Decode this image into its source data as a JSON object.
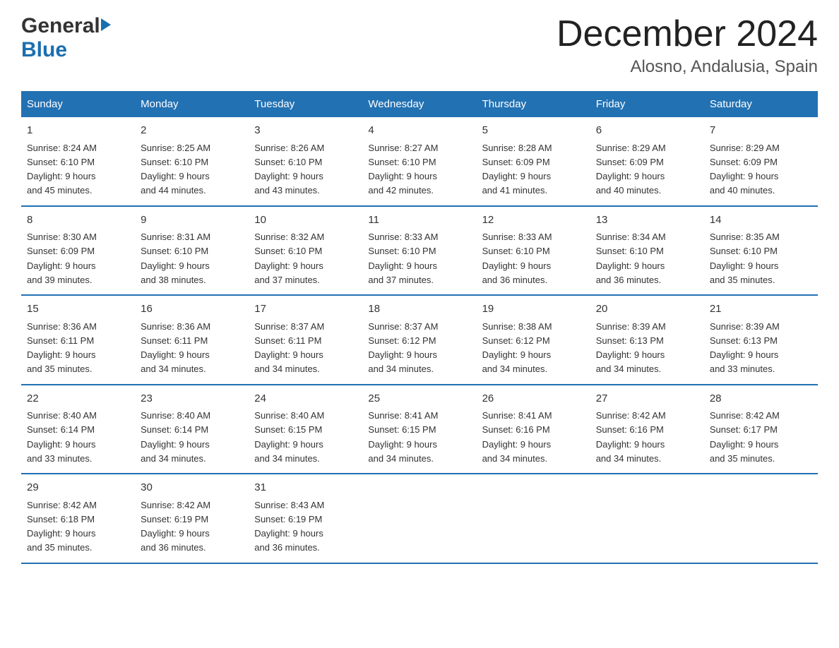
{
  "header": {
    "logo_general": "General",
    "logo_blue": "Blue",
    "title": "December 2024",
    "subtitle": "Alosno, Andalusia, Spain"
  },
  "weekdays": [
    "Sunday",
    "Monday",
    "Tuesday",
    "Wednesday",
    "Thursday",
    "Friday",
    "Saturday"
  ],
  "weeks": [
    [
      {
        "day": "1",
        "sunrise": "8:24 AM",
        "sunset": "6:10 PM",
        "daylight": "9 hours and 45 minutes."
      },
      {
        "day": "2",
        "sunrise": "8:25 AM",
        "sunset": "6:10 PM",
        "daylight": "9 hours and 44 minutes."
      },
      {
        "day": "3",
        "sunrise": "8:26 AM",
        "sunset": "6:10 PM",
        "daylight": "9 hours and 43 minutes."
      },
      {
        "day": "4",
        "sunrise": "8:27 AM",
        "sunset": "6:10 PM",
        "daylight": "9 hours and 42 minutes."
      },
      {
        "day": "5",
        "sunrise": "8:28 AM",
        "sunset": "6:09 PM",
        "daylight": "9 hours and 41 minutes."
      },
      {
        "day": "6",
        "sunrise": "8:29 AM",
        "sunset": "6:09 PM",
        "daylight": "9 hours and 40 minutes."
      },
      {
        "day": "7",
        "sunrise": "8:29 AM",
        "sunset": "6:09 PM",
        "daylight": "9 hours and 40 minutes."
      }
    ],
    [
      {
        "day": "8",
        "sunrise": "8:30 AM",
        "sunset": "6:09 PM",
        "daylight": "9 hours and 39 minutes."
      },
      {
        "day": "9",
        "sunrise": "8:31 AM",
        "sunset": "6:10 PM",
        "daylight": "9 hours and 38 minutes."
      },
      {
        "day": "10",
        "sunrise": "8:32 AM",
        "sunset": "6:10 PM",
        "daylight": "9 hours and 37 minutes."
      },
      {
        "day": "11",
        "sunrise": "8:33 AM",
        "sunset": "6:10 PM",
        "daylight": "9 hours and 37 minutes."
      },
      {
        "day": "12",
        "sunrise": "8:33 AM",
        "sunset": "6:10 PM",
        "daylight": "9 hours and 36 minutes."
      },
      {
        "day": "13",
        "sunrise": "8:34 AM",
        "sunset": "6:10 PM",
        "daylight": "9 hours and 36 minutes."
      },
      {
        "day": "14",
        "sunrise": "8:35 AM",
        "sunset": "6:10 PM",
        "daylight": "9 hours and 35 minutes."
      }
    ],
    [
      {
        "day": "15",
        "sunrise": "8:36 AM",
        "sunset": "6:11 PM",
        "daylight": "9 hours and 35 minutes."
      },
      {
        "day": "16",
        "sunrise": "8:36 AM",
        "sunset": "6:11 PM",
        "daylight": "9 hours and 34 minutes."
      },
      {
        "day": "17",
        "sunrise": "8:37 AM",
        "sunset": "6:11 PM",
        "daylight": "9 hours and 34 minutes."
      },
      {
        "day": "18",
        "sunrise": "8:37 AM",
        "sunset": "6:12 PM",
        "daylight": "9 hours and 34 minutes."
      },
      {
        "day": "19",
        "sunrise": "8:38 AM",
        "sunset": "6:12 PM",
        "daylight": "9 hours and 34 minutes."
      },
      {
        "day": "20",
        "sunrise": "8:39 AM",
        "sunset": "6:13 PM",
        "daylight": "9 hours and 34 minutes."
      },
      {
        "day": "21",
        "sunrise": "8:39 AM",
        "sunset": "6:13 PM",
        "daylight": "9 hours and 33 minutes."
      }
    ],
    [
      {
        "day": "22",
        "sunrise": "8:40 AM",
        "sunset": "6:14 PM",
        "daylight": "9 hours and 33 minutes."
      },
      {
        "day": "23",
        "sunrise": "8:40 AM",
        "sunset": "6:14 PM",
        "daylight": "9 hours and 34 minutes."
      },
      {
        "day": "24",
        "sunrise": "8:40 AM",
        "sunset": "6:15 PM",
        "daylight": "9 hours and 34 minutes."
      },
      {
        "day": "25",
        "sunrise": "8:41 AM",
        "sunset": "6:15 PM",
        "daylight": "9 hours and 34 minutes."
      },
      {
        "day": "26",
        "sunrise": "8:41 AM",
        "sunset": "6:16 PM",
        "daylight": "9 hours and 34 minutes."
      },
      {
        "day": "27",
        "sunrise": "8:42 AM",
        "sunset": "6:16 PM",
        "daylight": "9 hours and 34 minutes."
      },
      {
        "day": "28",
        "sunrise": "8:42 AM",
        "sunset": "6:17 PM",
        "daylight": "9 hours and 35 minutes."
      }
    ],
    [
      {
        "day": "29",
        "sunrise": "8:42 AM",
        "sunset": "6:18 PM",
        "daylight": "9 hours and 35 minutes."
      },
      {
        "day": "30",
        "sunrise": "8:42 AM",
        "sunset": "6:19 PM",
        "daylight": "9 hours and 36 minutes."
      },
      {
        "day": "31",
        "sunrise": "8:43 AM",
        "sunset": "6:19 PM",
        "daylight": "9 hours and 36 minutes."
      },
      null,
      null,
      null,
      null
    ]
  ],
  "labels": {
    "sunrise": "Sunrise:",
    "sunset": "Sunset:",
    "daylight": "Daylight:"
  }
}
